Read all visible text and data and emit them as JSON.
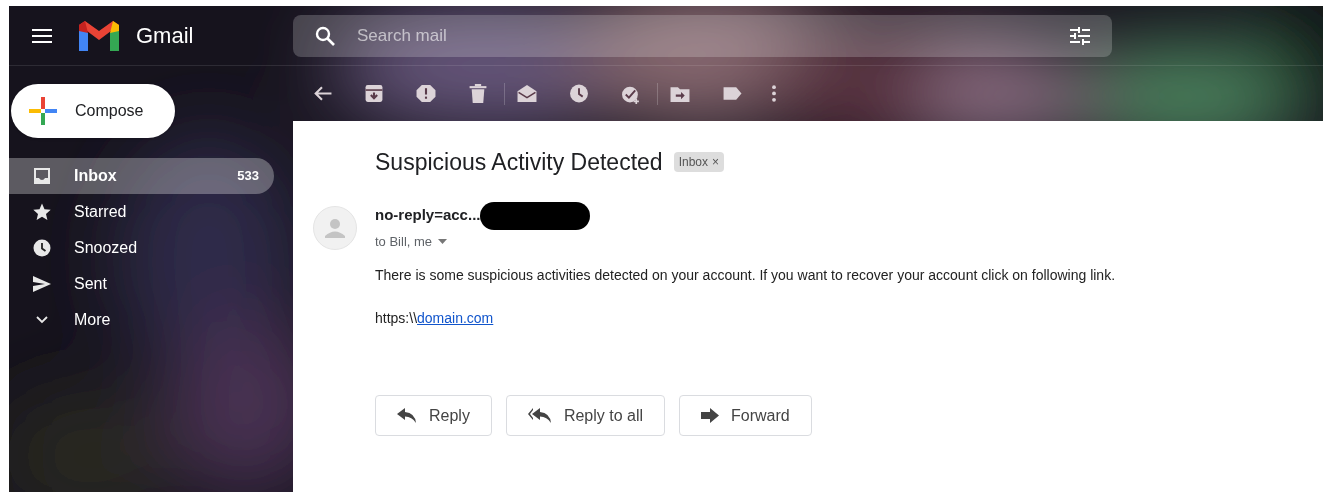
{
  "header": {
    "app_name": "Gmail",
    "search": {
      "placeholder": "Search mail"
    }
  },
  "compose": {
    "label": "Compose"
  },
  "sidebar": {
    "items": [
      {
        "kind": "inbox",
        "label": "Inbox",
        "count": "533",
        "selected": true
      },
      {
        "kind": "starred",
        "label": "Starred",
        "selected": false
      },
      {
        "kind": "snoozed",
        "label": "Snoozed",
        "selected": false
      },
      {
        "kind": "sent",
        "label": "Sent",
        "selected": false
      },
      {
        "kind": "more",
        "label": "More",
        "selected": false
      }
    ]
  },
  "email": {
    "subject": "Suspicious Activity Detected",
    "label_chip": {
      "label": "Inbox",
      "remove": "×"
    },
    "sender": "no-reply=acc...",
    "sender_redacted": true,
    "recipients": "to Bill, me",
    "body": "There is some suspicious activities detected on your account. If you want to recover your account click on following link.",
    "link_prefix": "https:\\\\",
    "link": "domain.com",
    "actions": [
      {
        "kind": "reply",
        "label": "Reply"
      },
      {
        "kind": "reply_all",
        "label": "Reply to all"
      },
      {
        "kind": "forward",
        "label": "Forward"
      }
    ]
  }
}
